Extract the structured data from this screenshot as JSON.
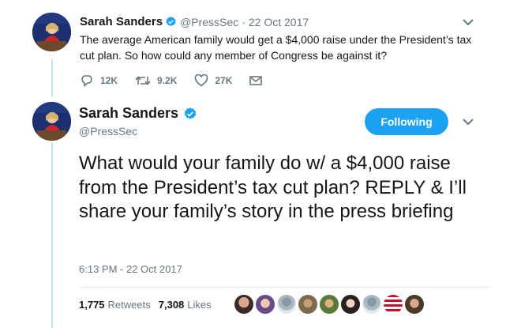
{
  "parent_tweet": {
    "name": "Sarah Sanders",
    "handle": "@PressSec",
    "separator": "·",
    "date": "22 Oct 2017",
    "text": "The average American family would get a $4,000 raise under the President’s tax cut plan. So how could any member of Congress be against it?",
    "replies": "12K",
    "retweets": "9.2K",
    "likes": "27K"
  },
  "main_tweet": {
    "name": "Sarah Sanders",
    "handle": "@PressSec",
    "follow_label": "Following",
    "text": "What would your family do w/ a $4,000 raise from the President’s tax cut plan? REPLY & I’ll share your family’s story in the press briefing",
    "timestamp": "6:13 PM - 22 Oct 2017",
    "retweets_count": "1,775",
    "retweets_label": "Retweets",
    "likes_count": "7,308",
    "likes_label": "Likes"
  },
  "colors": {
    "accent": "#1da1f2",
    "secondary_text": "#657786",
    "thread_line": "#c4e4f5"
  },
  "icons": [
    "reply-icon",
    "retweet-icon",
    "like-icon",
    "message-icon",
    "verified-badge-icon",
    "chevron-down-icon"
  ]
}
